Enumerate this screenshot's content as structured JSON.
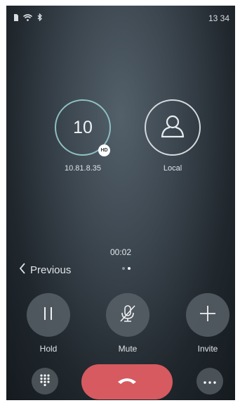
{
  "status_bar": {
    "time": "13 34",
    "icons": [
      "sd-card-icon",
      "wifi-icon",
      "bluetooth-icon"
    ]
  },
  "call": {
    "remote": {
      "number": "10",
      "address": "10.81.8.35",
      "badge": "HD"
    },
    "local": {
      "label": "Local",
      "icon": "user-icon"
    },
    "duration": "00:02",
    "page_indicator": {
      "pages": 2,
      "current": 2
    }
  },
  "navigation": {
    "previous_label": "Previous"
  },
  "actions": {
    "hold": "Hold",
    "mute": "Mute",
    "invite": "Invite"
  },
  "bottom_bar": {
    "dialpad_icon": "dialpad-icon",
    "end_call_icon": "end-call-icon",
    "more_icon": "more-icon"
  },
  "colors": {
    "end_call": "#d65a60",
    "remote_ring": "#8fc1c4",
    "button_bg": "#586067"
  }
}
